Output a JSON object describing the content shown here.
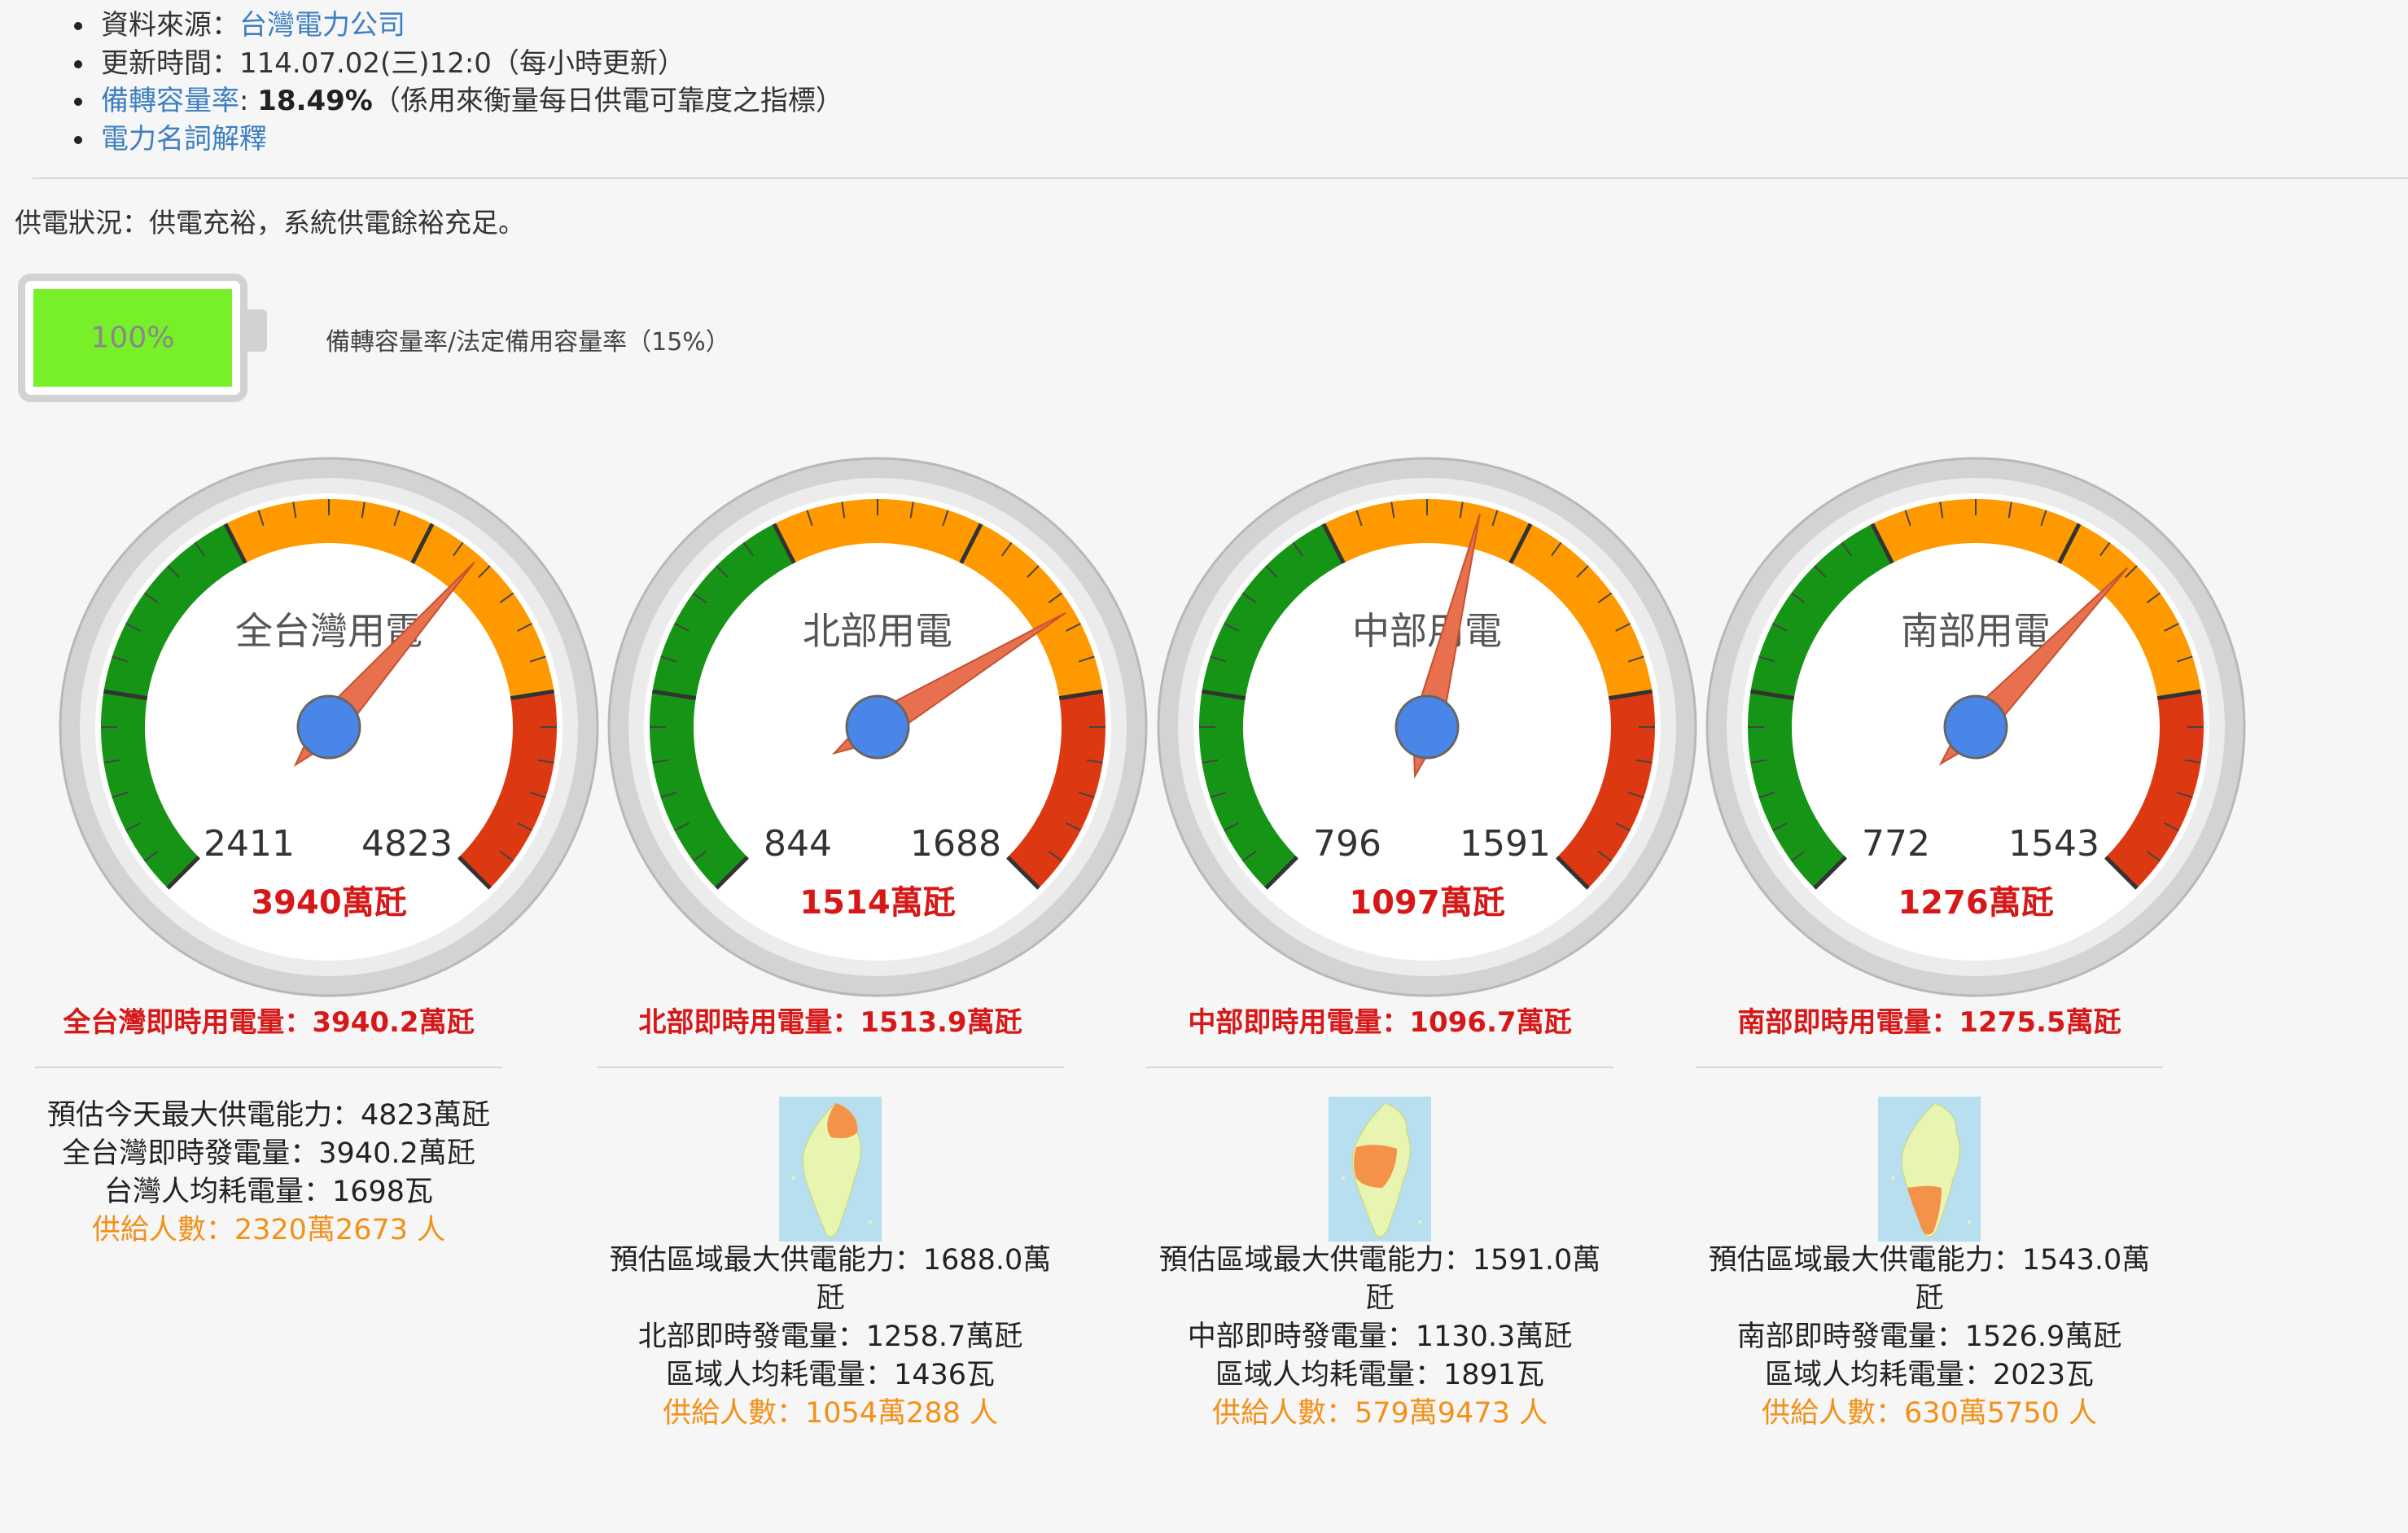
{
  "info": {
    "source_label": "資料來源：",
    "source_link": "台灣電力公司",
    "update_text": "更新時間：114.07.02(三)12:0（每小時更新）",
    "rate_link": "備轉容量率",
    "rate_colon": ": ",
    "rate_value": "18.49%",
    "rate_note": "（係用來衡量每日供電可靠度之指標）",
    "glossary_link": "電力名詞解釋"
  },
  "status_text": "供電狀況：供電充裕，系統供電餘裕充足。",
  "battery": {
    "level_percent": 100,
    "text": "100%",
    "label": "備轉容量率/法定備用容量率（15%）",
    "color": "#77f02a"
  },
  "colors": {
    "green": "#169416",
    "orange": "#ff9900",
    "red": "#dc3912",
    "needle": "#e8704f",
    "hub": "#4a86e8",
    "value_red": "#d71818",
    "accent_orange": "#f39018",
    "link_blue": "#3d7fc1"
  },
  "gauges": [
    {
      "title": "全台灣用電",
      "min": 0,
      "max": 4823,
      "yellow_from": 2411,
      "red_from": 4823,
      "red_to": 6029,
      "tick_low": "2411",
      "tick_high": "4823",
      "value": 3940,
      "value_text": "3940萬瓩",
      "realtime": "全台灣即時用電量：3940.2萬瓩",
      "details": [
        "預估今天最大供電能力：4823萬瓩",
        "全台灣即時發電量：3940.2萬瓩",
        "台灣人均耗電量：1698瓦"
      ],
      "people": "供給人數：2320萬2673 人",
      "map_icon": null
    },
    {
      "title": "北部用電",
      "min": 0,
      "max": 1688,
      "yellow_from": 844,
      "red_from": 1688,
      "red_to": 2110,
      "tick_low": "844",
      "tick_high": "1688",
      "value": 1514,
      "value_text": "1514萬瓩",
      "realtime": "北部即時用電量：1513.9萬瓩",
      "details": [
        "預估區域最大供電能力：1688.0萬瓩",
        "北部即時發電量：1258.7萬瓩",
        "區域人均耗電量：1436瓦"
      ],
      "people": "供給人數：1054萬288 人",
      "map_icon": "taiwan-north-map-icon"
    },
    {
      "title": "中部用電",
      "min": 0,
      "max": 1591,
      "yellow_from": 796,
      "red_from": 1591,
      "red_to": 1989,
      "tick_low": "796",
      "tick_high": "1591",
      "value": 1097,
      "value_text": "1097萬瓩",
      "realtime": "中部即時用電量：1096.7萬瓩",
      "details": [
        "預估區域最大供電能力：1591.0萬瓩",
        "中部即時發電量：1130.3萬瓩",
        "區域人均耗電量：1891瓦"
      ],
      "people": "供給人數：579萬9473 人",
      "map_icon": "taiwan-central-map-icon"
    },
    {
      "title": "南部用電",
      "min": 0,
      "max": 1543,
      "yellow_from": 772,
      "red_from": 1543,
      "red_to": 1929,
      "tick_low": "772",
      "tick_high": "1543",
      "value": 1276,
      "value_text": "1276萬瓩",
      "realtime": "南部即時用電量：1275.5萬瓩",
      "details": [
        "預估區域最大供電能力：1543.0萬瓩",
        "南部即時發電量：1526.9萬瓩",
        "區域人均耗電量：2023瓦"
      ],
      "people": "供給人數：630萬5750 人",
      "map_icon": "taiwan-south-map-icon"
    }
  ]
}
